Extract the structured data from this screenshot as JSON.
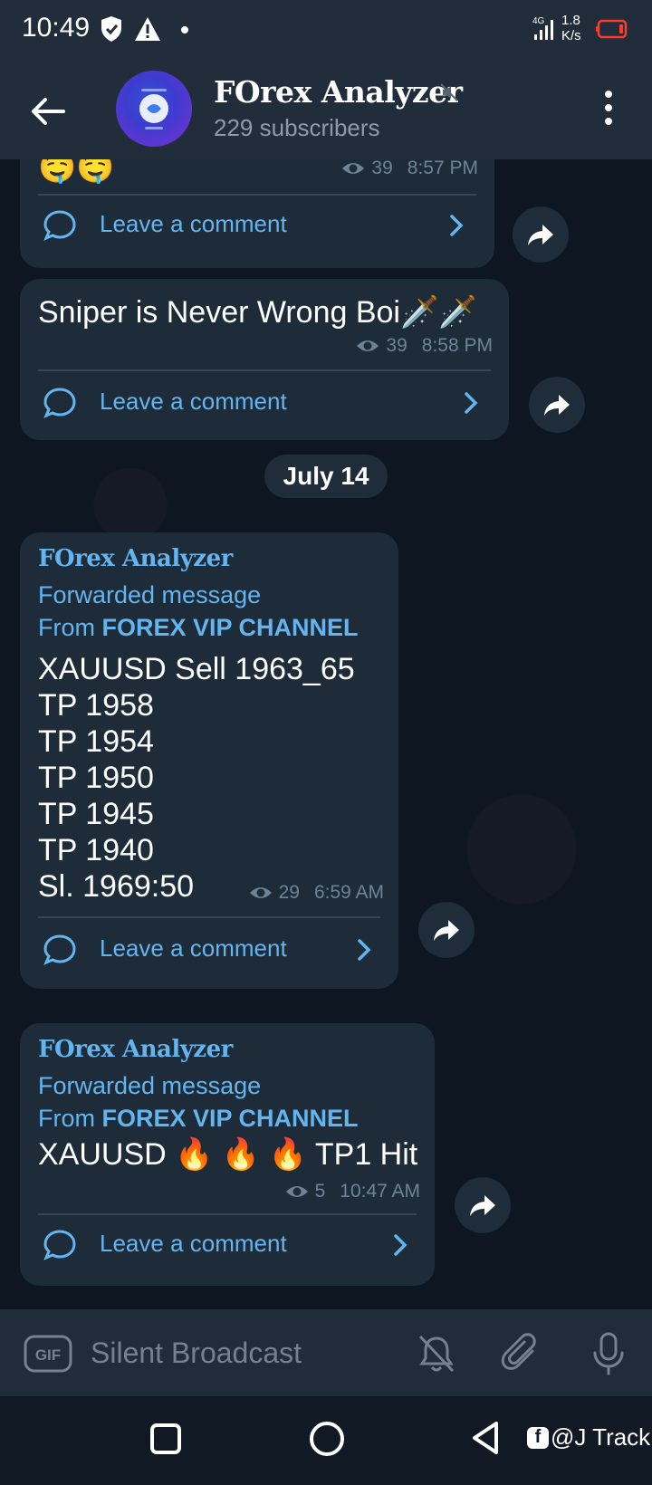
{
  "status_bar": {
    "time": "10:49",
    "network": "4G",
    "speed_value": "1.8",
    "speed_unit": "K/s"
  },
  "header": {
    "title": "FOrex Analyzer",
    "subscribers": "229 subscribers",
    "avatar_icon": "channel-logo"
  },
  "messages": [
    {
      "text": "🤤🤤",
      "views": "39",
      "time": "8:57 PM",
      "comment_label": "Leave a comment"
    },
    {
      "text": "Sniper is Never Wrong Boi🗡️🗡️",
      "views": "39",
      "time": "8:58 PM",
      "comment_label": "Leave a comment"
    },
    {
      "signature": "FOrex Analyzer",
      "forwarded_label": "Forwarded message",
      "from_prefix": "From",
      "from_channel": "FOREX VIP CHANNEL",
      "lines": [
        "XAUUSD Sell 1963_65",
        "TP 1958",
        "TP 1954",
        "TP 1950",
        "TP 1945",
        "TP 1940",
        "Sl. 1969:50"
      ],
      "views": "29",
      "time": "6:59 AM",
      "comment_label": "Leave a comment"
    },
    {
      "signature": "FOrex Analyzer",
      "forwarded_label": "Forwarded message",
      "from_prefix": "From",
      "from_channel": "FOREX VIP CHANNEL",
      "text": "XAUUSD 🔥 🔥 🔥 TP1 Hit",
      "views": "5",
      "time": "10:47 AM",
      "comment_label": "Leave a comment"
    }
  ],
  "date_separator": "July 14",
  "input_bar": {
    "gif_label": "GIF",
    "placeholder": "Silent Broadcast"
  },
  "watermark": {
    "fb_letter": "f",
    "text": "@J Track"
  },
  "colors": {
    "accent": "#64b5ef",
    "bubble": "#1e2c3a",
    "header": "#212d3b",
    "background": "#0e1621"
  }
}
